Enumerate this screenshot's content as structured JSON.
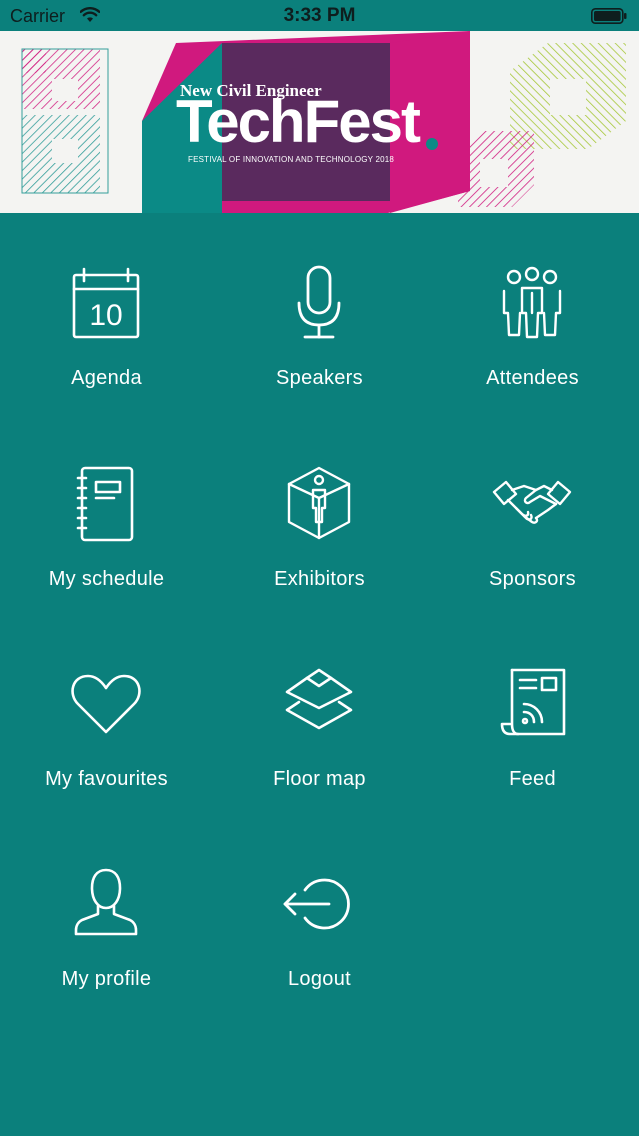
{
  "status_bar": {
    "carrier": "Carrier",
    "time": "3:33 PM"
  },
  "banner": {
    "publisher": "New Civil Engineer",
    "title": "TechFest",
    "subtitle": "FESTIVAL OF INNOVATION AND TECHNOLOGY 2018"
  },
  "menu": {
    "items": [
      {
        "label": "Agenda",
        "icon": "calendar-icon",
        "icon_text": "10"
      },
      {
        "label": "Speakers",
        "icon": "microphone-icon"
      },
      {
        "label": "Attendees",
        "icon": "people-group-icon"
      },
      {
        "label": "My schedule",
        "icon": "notebook-icon"
      },
      {
        "label": "Exhibitors",
        "icon": "exhibitor-hexagon-icon"
      },
      {
        "label": "Sponsors",
        "icon": "handshake-icon"
      },
      {
        "label": "My favourites",
        "icon": "heart-icon"
      },
      {
        "label": "Floor map",
        "icon": "layers-map-icon"
      },
      {
        "label": "Feed",
        "icon": "news-feed-icon"
      },
      {
        "label": "My profile",
        "icon": "user-profile-icon"
      },
      {
        "label": "Logout",
        "icon": "logout-icon"
      }
    ]
  },
  "colors": {
    "background": "#0b807c",
    "icon_stroke": "#ffffff",
    "banner_magenta": "#d0197e",
    "banner_purple": "#5a2a5e",
    "banner_teal": "#0b8a86",
    "banner_lime": "#a7c83a"
  }
}
